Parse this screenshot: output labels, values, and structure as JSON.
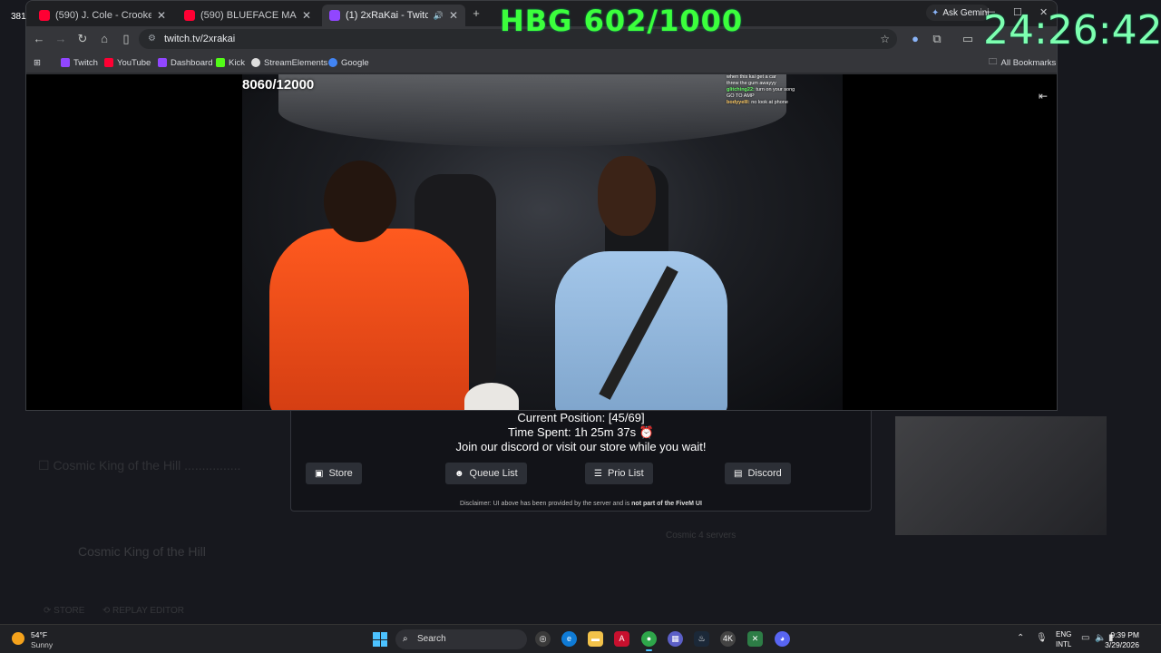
{
  "overlay": {
    "hbg_counter": "HBG 602/1000",
    "timer": "24:26:42",
    "corner_number": "381"
  },
  "browser": {
    "tabs": [
      {
        "label": "(590) J. Cole - Crooked Sm",
        "favicon_color": "#ff0033"
      },
      {
        "label": "(590) BLUEFACE MADE THE GIR",
        "favicon_color": "#ff0033"
      },
      {
        "label": "(1) 2xRaKai - Twitch",
        "favicon_color": "#9146ff"
      }
    ],
    "new_tab_icon": "plus-icon",
    "ask_gemini": "Ask Gemini",
    "url": "twitch.tv/2xrakai",
    "bookmarks": [
      {
        "label": "Twitch",
        "color": "#9146ff"
      },
      {
        "label": "YouTube",
        "color": "#ff0033"
      },
      {
        "label": "Dashboard",
        "color": "#9146ff"
      },
      {
        "label": "Kick",
        "color": "#53fc18"
      },
      {
        "label": "StreamElements",
        "color": "#dddddd"
      },
      {
        "label": "Google",
        "color": "#4285f4"
      }
    ],
    "all_bookmarks": "All Bookmarks"
  },
  "video": {
    "counter": "8060/12000",
    "chat": [
      {
        "user": "",
        "msg": "when this kai get a car"
      },
      {
        "user": "",
        "msg": "threw the gum awayyy"
      },
      {
        "user": "glitching22:",
        "msg": "turn on your song"
      },
      {
        "user": "",
        "msg": ""
      },
      {
        "user": "",
        "msg": "GO TO AMP"
      },
      {
        "user": "bodyyelll:",
        "msg": "no look at phone"
      }
    ]
  },
  "queue": {
    "position_line": "Current Position: [45/69]",
    "time_line": "Time Spent: 1h 25m 37s ⏰",
    "join_line": "Join our discord or visit our store while you wait!",
    "buttons": {
      "store": "Store",
      "queue_list": "Queue List",
      "prio_list": "Prio List",
      "discord": "Discord"
    },
    "disclaimer": "Disclaimer: UI above has been provided by the server and is",
    "disclaimer_bold": "not part of the FiveM UI"
  },
  "background_app": {
    "server_title": "Cosmic King of the Hill"
  },
  "taskbar": {
    "weather_temp": "54°F",
    "weather_desc": "Sunny",
    "search": "Search",
    "lang_top": "ENG",
    "lang_bottom": "INTL",
    "time": "9:39 PM",
    "date": "3/29/2026"
  }
}
